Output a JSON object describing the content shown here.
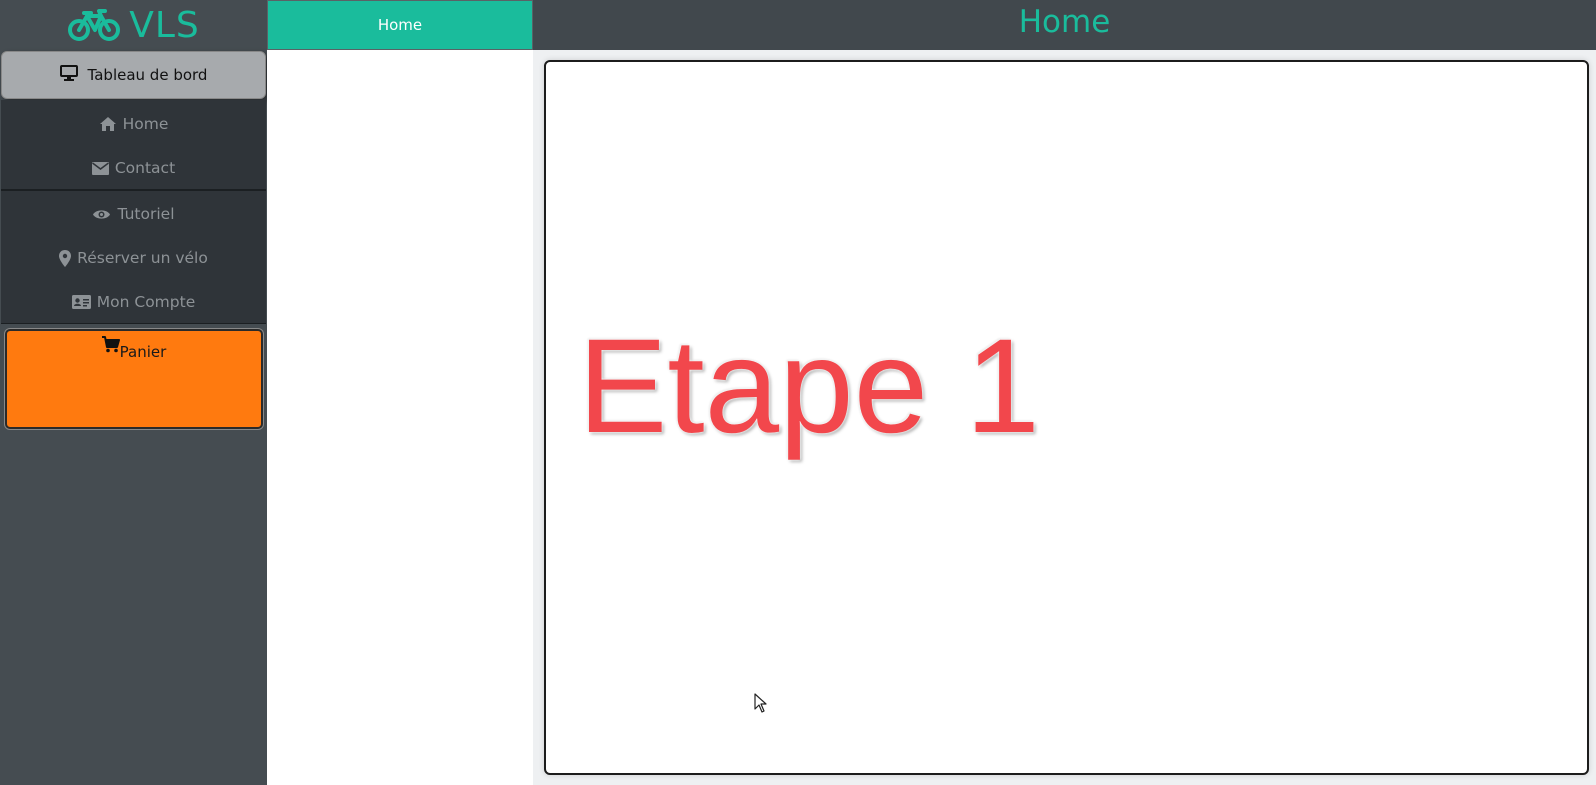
{
  "brand": {
    "name": "VLS",
    "icon": "bicycle-icon",
    "color": "#1abc9c"
  },
  "dashboard_button": {
    "label": "Tableau de bord",
    "icon": "desktop-icon"
  },
  "menu_group_1": [
    {
      "label": "Home",
      "icon": "home-icon"
    },
    {
      "label": "Contact",
      "icon": "envelope-icon"
    }
  ],
  "menu_group_2": [
    {
      "label": "Tutoriel",
      "icon": "eye-icon"
    },
    {
      "label": "Réserver un vélo",
      "icon": "map-marker-icon"
    },
    {
      "label": "Mon Compte",
      "icon": "id-card-icon"
    }
  ],
  "cart": {
    "label": "Panier",
    "icon": "shopping-cart-icon",
    "color": "#ff7a0f"
  },
  "top_tab": {
    "label": "Home"
  },
  "header": {
    "title": "Home"
  },
  "content": {
    "step_text": "Etape 1",
    "step_color": "#f2474c"
  }
}
